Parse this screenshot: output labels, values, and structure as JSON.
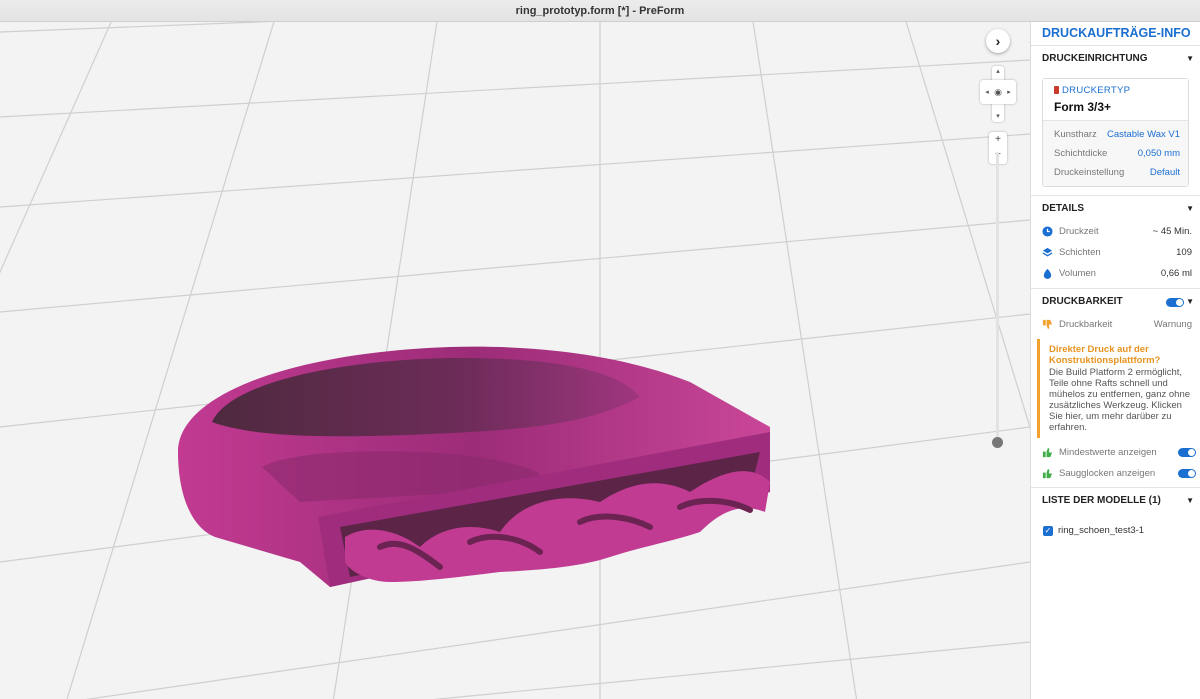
{
  "window": {
    "title": "ring_prototyp.form [*] - PreForm"
  },
  "viewport": {
    "model_name": "ring",
    "model_color": "#b0307f",
    "orbit_arrows": [
      "▴",
      "▾",
      "◂",
      "▸"
    ],
    "zoom_in": "+",
    "zoom_out": "−",
    "next": "›"
  },
  "sidebar": {
    "title": "DRUCKAUFTRÄGE-INFO",
    "accent": "#1b6fd1",
    "setup": {
      "header": "DRUCKEINRICHTUNG",
      "printer_type_label": "DRUCKERTYP",
      "printer_model": "Form 3/3+",
      "rows": [
        {
          "label": "Kunstharz",
          "value": "Castable Wax V1"
        },
        {
          "label": "Schichtdicke",
          "value": "0,050 mm"
        },
        {
          "label": "Druckeinstellung",
          "value": "Default"
        }
      ]
    },
    "details": {
      "header": "DETAILS",
      "rows": [
        {
          "icon": "clock-icon",
          "label": "Druckzeit",
          "value": "~ 45 Min."
        },
        {
          "icon": "layers-icon",
          "label": "Schichten",
          "value": "109"
        },
        {
          "icon": "volume-icon",
          "label": "Volumen",
          "value": "0,66 ml"
        }
      ]
    },
    "printability": {
      "header": "DRUCKBARKEIT",
      "row": {
        "label": "Druckbarkeit",
        "value": "Warnung"
      },
      "warning_title": "Direkter Druck auf der Konstruktionsplattform?",
      "warning_body": "Die Build Platform 2 ermöglicht, Teile ohne Rafts schnell und mühelos zu entfernen, ganz ohne zusätzliches Werkzeug. Klicken Sie hier, um mehr darüber zu erfahren.",
      "warning_color": "#f2a12a",
      "toggles": [
        {
          "label": "Mindestwerte anzeigen",
          "on": true
        },
        {
          "label": "Saugglocken anzeigen",
          "on": true
        }
      ]
    },
    "models": {
      "header": "LISTE DER MODELLE (1)",
      "items": [
        {
          "name": "ring_schoen_test3-1",
          "checked": true
        }
      ]
    }
  }
}
